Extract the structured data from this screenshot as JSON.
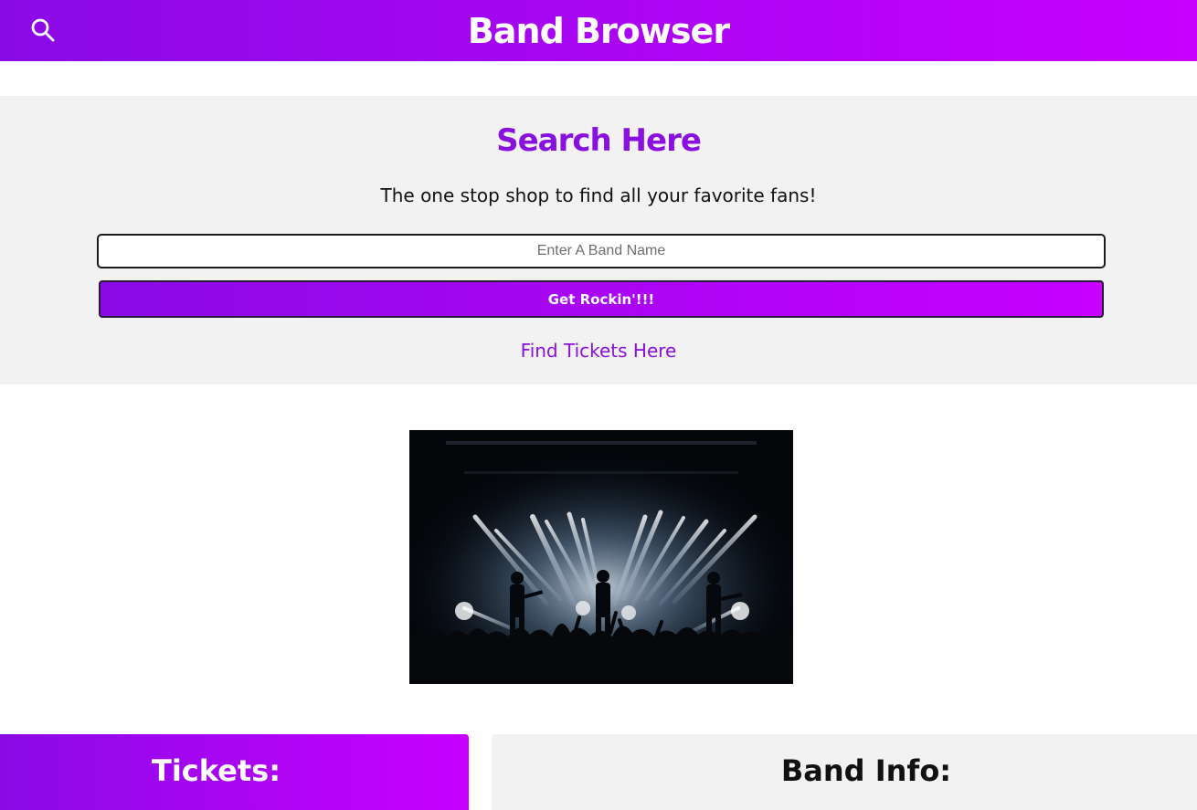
{
  "header": {
    "title": "Band Browser",
    "search_icon": "search-icon",
    "gradient": [
      "#8a0ae6",
      "#c800ff"
    ]
  },
  "search_section": {
    "heading": "Search Here",
    "tagline": "The one stop shop to find all your favorite fans!",
    "input_placeholder": "Enter A Band Name",
    "input_value": "",
    "button_label": "Get Rockin'!!!",
    "tickets_link": "Find Tickets Here",
    "accent_color": "#8a10e0"
  },
  "hero_image": {
    "icon": "concert-stage-photo"
  },
  "panels": {
    "tickets_title": "Tickets:",
    "band_info_title": "Band Info:"
  }
}
